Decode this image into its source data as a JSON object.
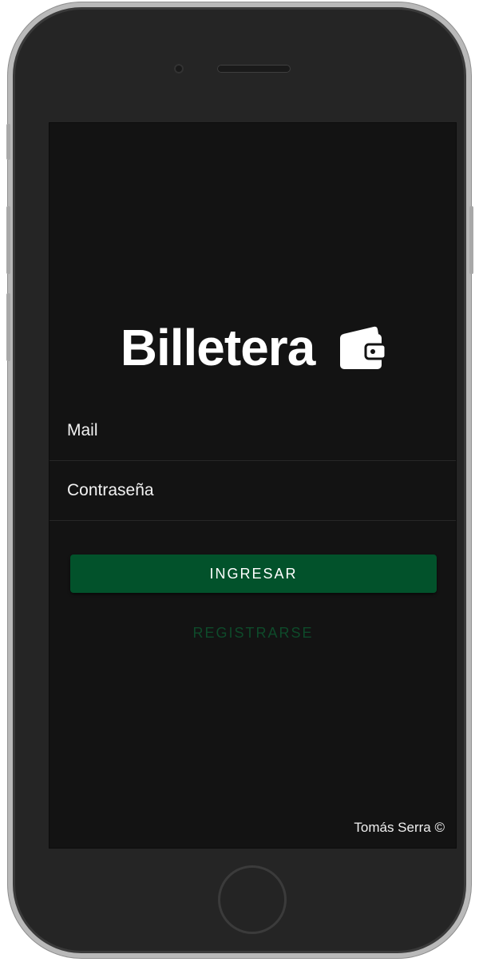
{
  "app": {
    "title": "Billetera",
    "icon": "wallet-icon"
  },
  "form": {
    "mail_placeholder": "Mail",
    "mail_value": "",
    "password_placeholder": "Contraseña",
    "password_value": ""
  },
  "actions": {
    "login_label": "INGRESAR",
    "register_label": "REGISTRARSE"
  },
  "footer": {
    "credit": "Tomás Serra ©"
  },
  "colors": {
    "background": "#131313",
    "primary_button": "#02522b",
    "link": "#0e4a2a",
    "text": "#ffffff"
  }
}
